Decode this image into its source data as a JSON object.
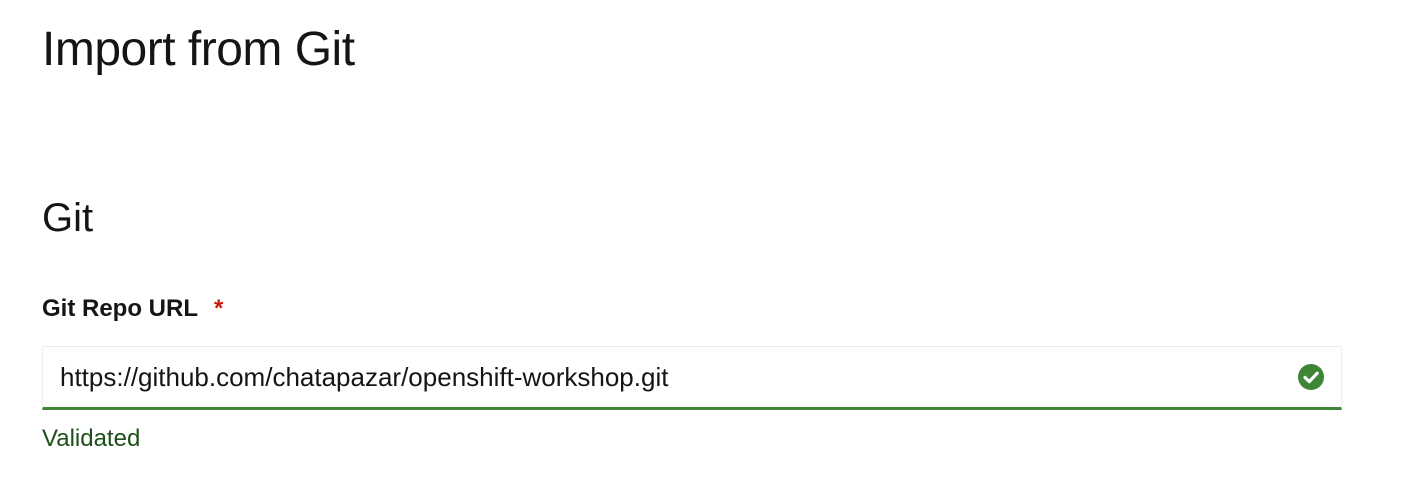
{
  "page": {
    "title": "Import from Git"
  },
  "git_section": {
    "title": "Git",
    "repo_url": {
      "label": "Git Repo URL",
      "required_mark": "*",
      "value": "https://github.com/chatapazar/openshift-workshop.git",
      "status_icon": "check-circle-icon",
      "helper_text": "Validated"
    }
  },
  "colors": {
    "success": "#3e8635",
    "success_text": "#1e4f18",
    "required": "#c9190b",
    "text": "#151515"
  }
}
